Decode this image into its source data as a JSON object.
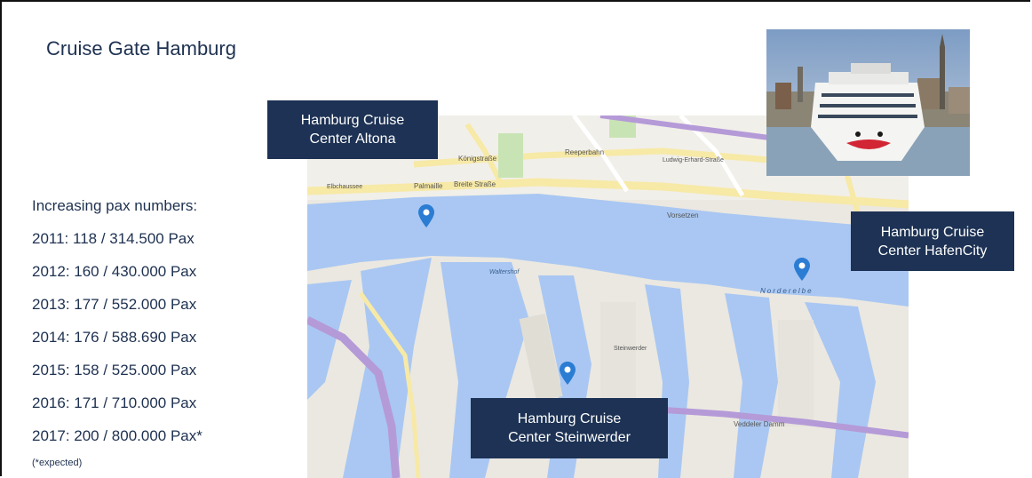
{
  "title": "Cruise Gate Hamburg",
  "stats": {
    "heading": "Increasing pax numbers:",
    "rows": [
      "2011: 118 /  314.500 Pax",
      "2012: 160 /  430.000 Pax",
      "2013: 177 /  552.000 Pax",
      "2014: 176 /  588.690 Pax",
      "2015: 158 /  525.000 Pax",
      "2016: 171 /  710.000 Pax",
      "2017: 200 /  800.000 Pax*"
    ],
    "note": "(*expected)"
  },
  "labels": {
    "altona": [
      "Hamburg Cruise",
      "Center Altona"
    ],
    "hafencity": [
      "Hamburg Cruise",
      "Center HafenCity"
    ],
    "steinwerder": [
      "Hamburg Cruise",
      "Center Steinwerder"
    ]
  },
  "map_text": {
    "street1": "Königstraße",
    "street2": "Reeperbahn",
    "street3": "Palmaille",
    "street4": "Breite Straße",
    "street5": "Ludwig-Erhard-Straße",
    "street6": "Vorsetzen",
    "street7": "Veddeler Damm",
    "street8": "Elbchaussee",
    "water1": "Norderelbe",
    "area1": "Waltershof",
    "area2": "Steinwerder"
  },
  "colors": {
    "navy": "#1d3254",
    "water": "#a9c7f2",
    "land": "#e9e6df",
    "road_yellow": "#f7e9a6",
    "motorway": "#b59ad8",
    "pin": "#2b7cd3"
  },
  "icons": [
    "map-pin-icon"
  ]
}
